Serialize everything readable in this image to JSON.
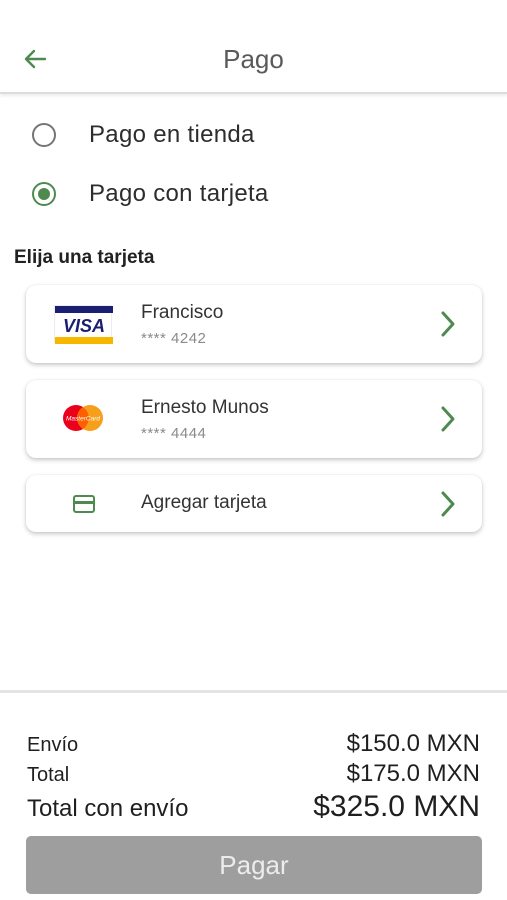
{
  "header": {
    "title": "Pago",
    "back_icon": "arrow-left-icon"
  },
  "payment_options": [
    {
      "label": "Pago en tienda",
      "selected": false
    },
    {
      "label": "Pago con tarjeta",
      "selected": true
    }
  ],
  "cards_section": {
    "title": "Elija una tarjeta"
  },
  "cards": [
    {
      "brand": "VISA",
      "name": "Francisco",
      "number": "**** 4242"
    },
    {
      "brand": "MasterCard",
      "name": "Ernesto Munos",
      "number": "**** 4444"
    }
  ],
  "add_card": {
    "label": "Agregar tarjeta",
    "icon": "credit-card-icon"
  },
  "summary": {
    "shipping_label": "Envío",
    "shipping_value": "$150.0 MXN",
    "total_label": "Total",
    "total_value": "$175.0 MXN",
    "grand_label": "Total con envío",
    "grand_value": "$325.0 MXN"
  },
  "pay_button": {
    "label": "Pagar"
  },
  "colors": {
    "accent": "#4e8a4f",
    "button_disabled": "#9e9e9e"
  }
}
